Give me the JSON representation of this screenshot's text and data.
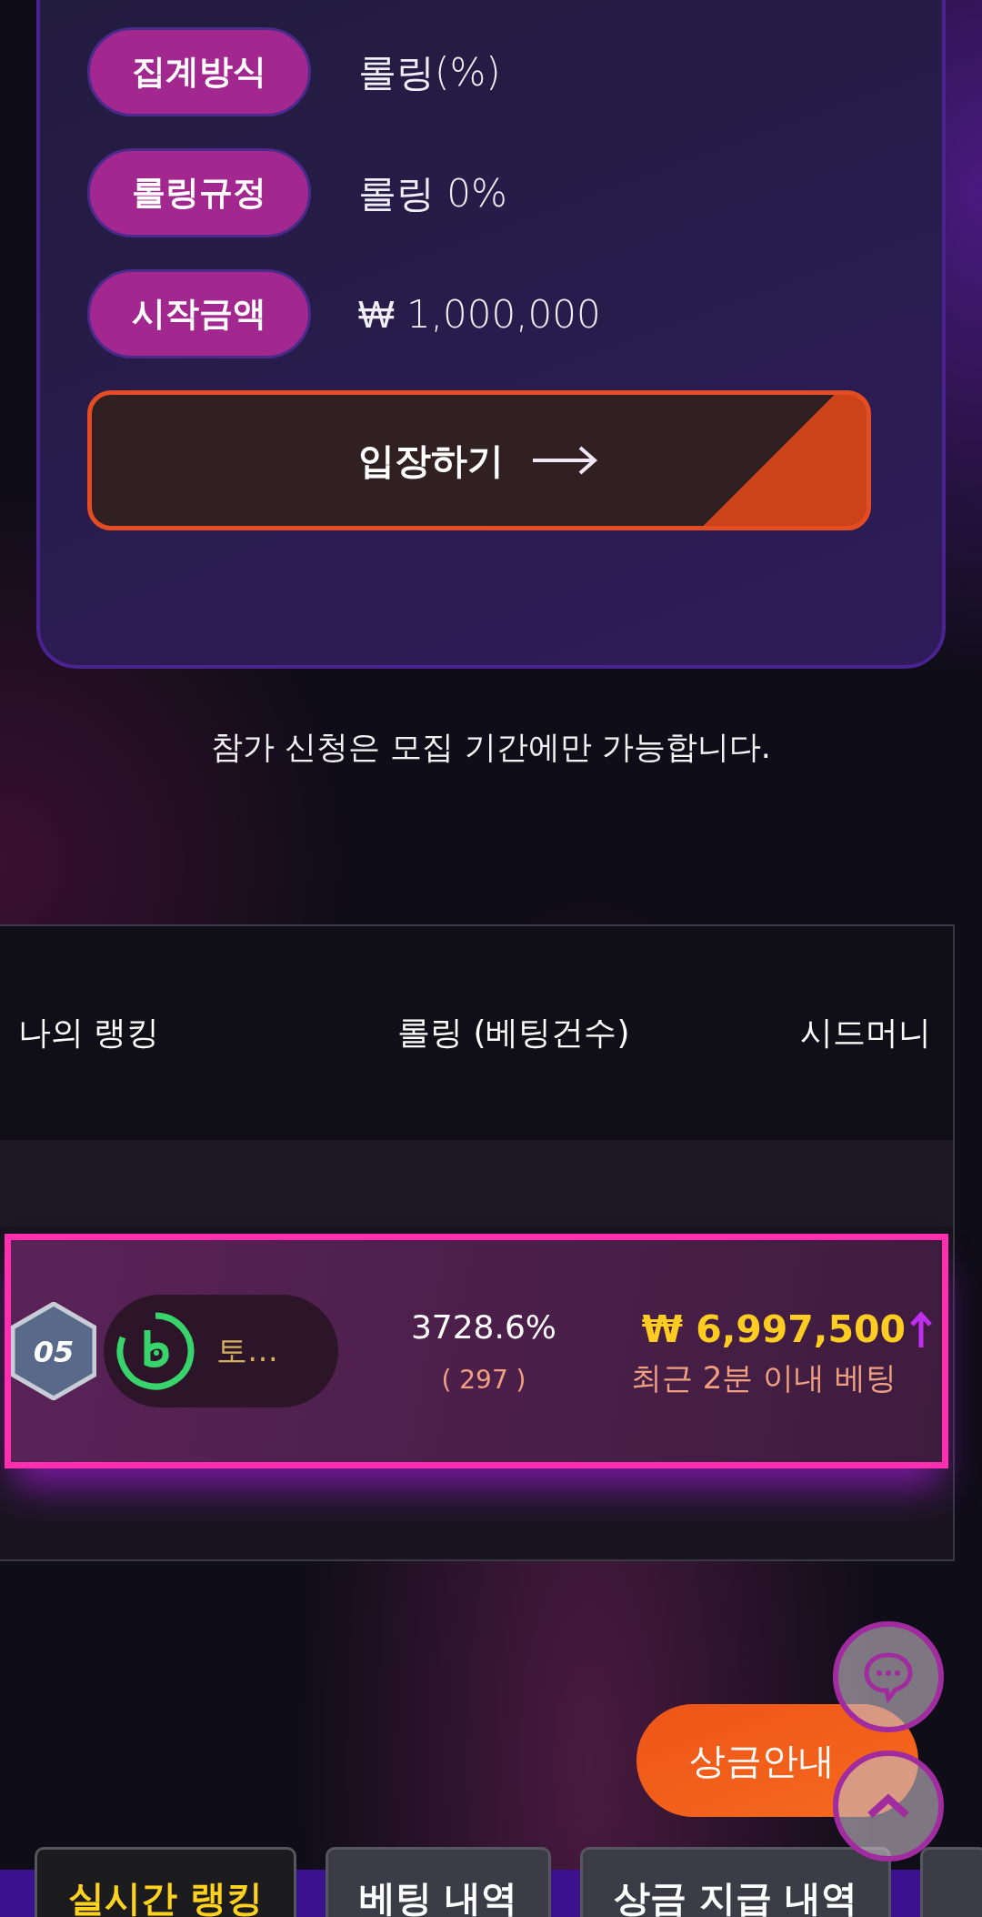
{
  "info_rows": [
    {
      "label": "집계방식",
      "value": "롤링(%)"
    },
    {
      "label": "롤링규정",
      "value": "롤링 0%"
    },
    {
      "label": "시작금액",
      "value": "₩ 1,000,000"
    }
  ],
  "enter_button": {
    "label": "입장하기"
  },
  "notice": "참가 신청은 모집 기간에만 가능합니다.",
  "ranking": {
    "columns": [
      "나의 랭킹",
      "롤링 (베팅건수)",
      "시드머니"
    ],
    "rows": [
      {
        "rank": "05",
        "name": "토…",
        "rolling": "3728.6%",
        "bet_count": "( 297 )",
        "seed_money": "₩ 6,997,500",
        "rising": true,
        "note": "최근 2분 이내 베팅",
        "highlighted": true
      }
    ]
  },
  "prize_button": {
    "label": "상금안내"
  },
  "tabs": [
    {
      "label": "실시간 랭킹",
      "selected": true
    },
    {
      "label": "베팅 내역",
      "selected": false
    },
    {
      "label": "상금 지급 내역",
      "selected": false
    }
  ]
}
